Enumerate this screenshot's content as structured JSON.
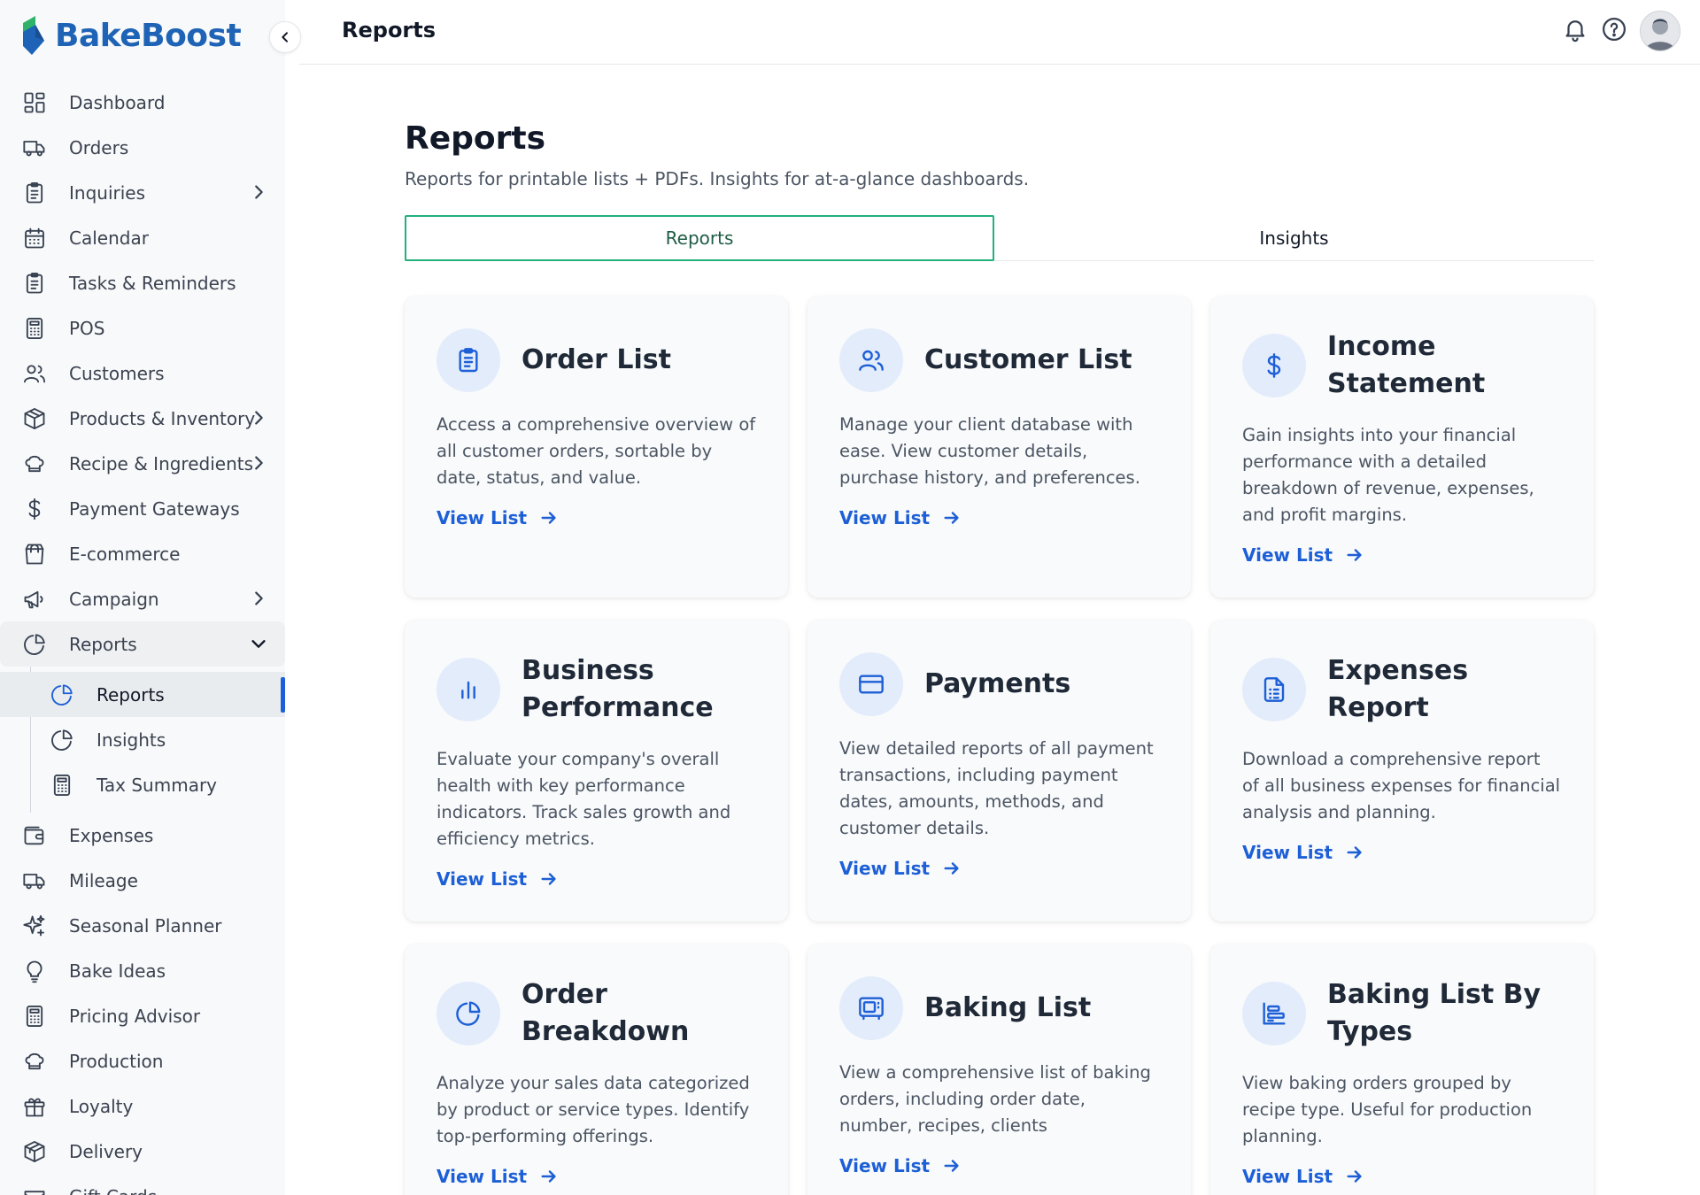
{
  "app": {
    "name": "BakeBoost"
  },
  "topbar": {
    "title": "Reports"
  },
  "sidebar": {
    "items": [
      {
        "label": "Dashboard",
        "icon": "dashboard-icon"
      },
      {
        "label": "Orders",
        "icon": "truck-icon"
      },
      {
        "label": "Inquiries",
        "icon": "clipboard-icon",
        "has_children": true
      },
      {
        "label": "Calendar",
        "icon": "calendar-icon"
      },
      {
        "label": "Tasks & Reminders",
        "icon": "clipboard-icon"
      },
      {
        "label": "POS",
        "icon": "calculator-icon"
      },
      {
        "label": "Customers",
        "icon": "users-icon"
      },
      {
        "label": "Products & Inventory",
        "icon": "box-icon",
        "has_children": true
      },
      {
        "label": "Recipe & Ingredients",
        "icon": "chef-hat-icon",
        "has_children": true
      },
      {
        "label": "Payment Gateways",
        "icon": "dollar-icon"
      },
      {
        "label": "E-commerce",
        "icon": "shopping-bag-icon"
      },
      {
        "label": "Campaign",
        "icon": "megaphone-icon",
        "has_children": true
      },
      {
        "label": "Reports",
        "icon": "pie-chart-icon",
        "expanded": true
      }
    ],
    "reports_sub": [
      {
        "label": "Reports",
        "icon": "pie-chart-icon",
        "active": true
      },
      {
        "label": "Insights",
        "icon": "pie-chart-icon"
      },
      {
        "label": "Tax Summary",
        "icon": "calculator-icon"
      }
    ],
    "items_after": [
      {
        "label": "Expenses",
        "icon": "wallet-icon"
      },
      {
        "label": "Mileage",
        "icon": "truck-icon"
      },
      {
        "label": "Seasonal Planner",
        "icon": "sparkles-icon"
      },
      {
        "label": "Bake Ideas",
        "icon": "lightbulb-icon"
      },
      {
        "label": "Pricing Advisor",
        "icon": "calculator-icon"
      },
      {
        "label": "Production",
        "icon": "chef-hat-icon"
      },
      {
        "label": "Loyalty",
        "icon": "gift-icon"
      },
      {
        "label": "Delivery",
        "icon": "package-icon"
      },
      {
        "label": "Gift Cards",
        "icon": "ticket-icon"
      }
    ]
  },
  "main": {
    "title": "Reports",
    "subtitle": "Reports for printable lists + PDFs. Insights for at-a-glance dashboards.",
    "tabs": [
      {
        "label": "Reports",
        "active": true
      },
      {
        "label": "Insights",
        "active": false
      }
    ],
    "link_label": "View List",
    "cards": [
      {
        "title": "Order List",
        "icon": "clipboard-icon",
        "desc": "Access a comprehensive overview of all customer orders, sortable by date, status, and value."
      },
      {
        "title": "Customer List",
        "icon": "users-icon",
        "desc": "Manage your client database with ease. View customer details, purchase history, and preferences."
      },
      {
        "title": "Income Statement",
        "icon": "dollar-icon",
        "desc": "Gain insights into your financial performance with a detailed breakdown of revenue, expenses, and profit margins."
      },
      {
        "title": "Business Performance",
        "icon": "bar-chart-icon",
        "desc": "Evaluate your company's overall health with key performance indicators. Track sales growth and efficiency metrics."
      },
      {
        "title": "Payments",
        "icon": "credit-card-icon",
        "desc": "View detailed reports of all payment transactions, including payment dates, amounts, methods, and customer details."
      },
      {
        "title": "Expenses Report",
        "icon": "file-list-icon",
        "desc": "Download a comprehensive report of all business expenses for financial analysis and planning."
      },
      {
        "title": "Order Breakdown",
        "icon": "pie-chart-icon",
        "desc": "Analyze your sales data categorized by product or service types. Identify top-performing offerings."
      },
      {
        "title": "Baking List",
        "icon": "oven-icon",
        "desc": "View a comprehensive list of baking orders, including order date, number, recipes, clients"
      },
      {
        "title": "Baking List By Types",
        "icon": "list-layout-icon",
        "desc": "View baking orders grouped by recipe type. Useful for production planning."
      }
    ]
  },
  "colors": {
    "brand": "#1e63b5",
    "accent_tab": "#22b07d",
    "link": "#1d5fd6",
    "icon_bg": "#e3ecfb"
  }
}
